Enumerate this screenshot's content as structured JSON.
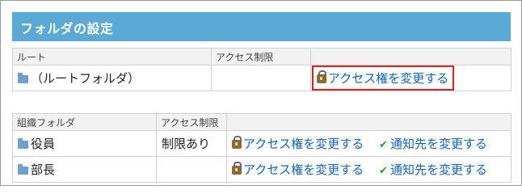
{
  "page": {
    "title": "フォルダの設定"
  },
  "root_table": {
    "headers": [
      "ルート",
      "アクセス制限",
      ""
    ],
    "row": {
      "folder_name": "（ルートフォルダ）",
      "restriction": "",
      "access_link": "アクセス権を変更する"
    }
  },
  "org_table": {
    "headers": [
      "組織フォルダ",
      "アクセス制限",
      ""
    ],
    "rows": [
      {
        "folder_name": "役員",
        "restriction": "制限あり",
        "access_link": "アクセス権を変更する",
        "notify_link": "通知先を変更する"
      },
      {
        "folder_name": "部長",
        "restriction": "",
        "access_link": "アクセス権を変更する",
        "notify_link": "通知先を変更する"
      }
    ]
  },
  "icons": {
    "folder": "folder-icon",
    "lock": "lock-icon",
    "check": "check-icon"
  },
  "colors": {
    "title_bar": "#5baad6",
    "link": "#1565b4",
    "highlight": "#e02020",
    "check": "#33a02c"
  }
}
